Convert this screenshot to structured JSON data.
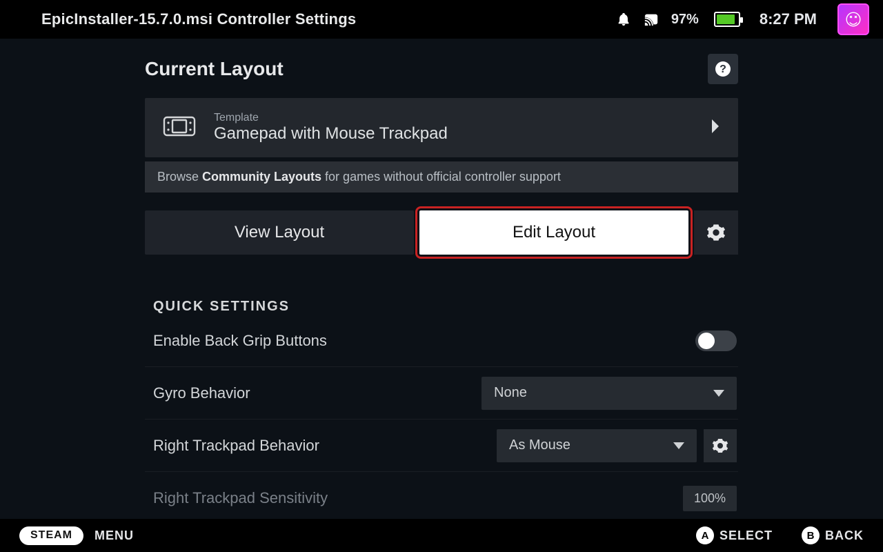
{
  "header": {
    "title": "EpicInstaller-15.7.0.msi Controller Settings",
    "battery_pct": "97%",
    "clock": "8:27 PM"
  },
  "layout": {
    "section_title": "Current Layout",
    "template_label": "Template",
    "template_name": "Gamepad with Mouse Trackpad",
    "community_prefix": "Browse ",
    "community_bold": "Community Layouts",
    "community_suffix": " for games without official controller support",
    "view_btn": "View Layout",
    "edit_btn": "Edit Layout"
  },
  "quick": {
    "heading": "QUICK SETTINGS",
    "rows": {
      "back_grip": "Enable Back Grip Buttons",
      "gyro_label": "Gyro Behavior",
      "gyro_value": "None",
      "rt_behavior_label": "Right Trackpad Behavior",
      "rt_behavior_value": "As Mouse",
      "rt_sens_label": "Right Trackpad Sensitivity",
      "rt_sens_value": "100%"
    }
  },
  "footer": {
    "steam": "STEAM",
    "menu": "MENU",
    "a_glyph": "A",
    "a_label": "SELECT",
    "b_glyph": "B",
    "b_label": "BACK"
  }
}
